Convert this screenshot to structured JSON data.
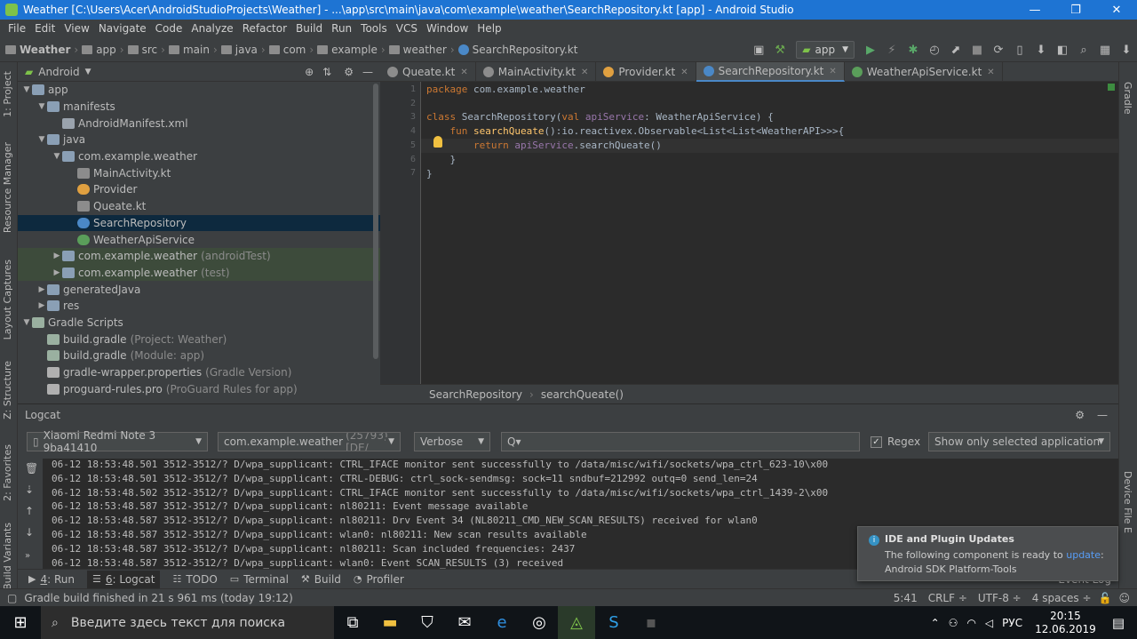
{
  "title": "Weather [C:\\Users\\Acer\\AndroidStudioProjects\\Weather] - ...\\app\\src\\main\\java\\com\\example\\weather\\SearchRepository.kt [app] - Android Studio",
  "menu": [
    "File",
    "Edit",
    "View",
    "Navigate",
    "Code",
    "Analyze",
    "Refactor",
    "Build",
    "Run",
    "Tools",
    "VCS",
    "Window",
    "Help"
  ],
  "breadcrumbs": [
    "Weather",
    "app",
    "src",
    "main",
    "java",
    "com",
    "example",
    "weather",
    "SearchRepository.kt"
  ],
  "run_config": "app",
  "left_tabs": [
    "1: Project",
    "Resource Manager",
    "Layout Captures",
    "Z: Structure",
    "2: Favorites",
    "Build Variants"
  ],
  "right_tabs": [
    "Gradle",
    "Device File E"
  ],
  "project": {
    "view": "Android",
    "tree": [
      {
        "label": "app",
        "extra": "",
        "indent": 0,
        "arrow": "▼",
        "icon": "folder",
        "sel": false,
        "hl": false
      },
      {
        "label": "manifests",
        "extra": "",
        "indent": 1,
        "arrow": "▼",
        "icon": "folder",
        "sel": false,
        "hl": false
      },
      {
        "label": "AndroidManifest.xml",
        "extra": "",
        "indent": 2,
        "arrow": "",
        "icon": "xml",
        "sel": false,
        "hl": false
      },
      {
        "label": "java",
        "extra": "",
        "indent": 1,
        "arrow": "▼",
        "icon": "folder",
        "sel": false,
        "hl": false
      },
      {
        "label": "com.example.weather",
        "extra": "",
        "indent": 2,
        "arrow": "▼",
        "icon": "folder",
        "sel": false,
        "hl": false
      },
      {
        "label": "MainActivity.kt",
        "extra": "",
        "indent": 3,
        "arrow": "",
        "icon": "kt",
        "sel": false,
        "hl": false
      },
      {
        "label": "Provider",
        "extra": "",
        "indent": 3,
        "arrow": "",
        "icon": "obj",
        "sel": false,
        "hl": false
      },
      {
        "label": "Queate.kt",
        "extra": "",
        "indent": 3,
        "arrow": "",
        "icon": "kt",
        "sel": false,
        "hl": false
      },
      {
        "label": "SearchRepository",
        "extra": "",
        "indent": 3,
        "arrow": "",
        "icon": "cls",
        "sel": true,
        "hl": false
      },
      {
        "label": "WeatherApiService",
        "extra": "",
        "indent": 3,
        "arrow": "",
        "icon": "iface",
        "sel": false,
        "hl": false
      },
      {
        "label": "com.example.weather",
        "extra": "(androidTest)",
        "indent": 2,
        "arrow": "▶",
        "icon": "folder",
        "sel": false,
        "hl": true
      },
      {
        "label": "com.example.weather",
        "extra": "(test)",
        "indent": 2,
        "arrow": "▶",
        "icon": "folder",
        "sel": false,
        "hl": true
      },
      {
        "label": "generatedJava",
        "extra": "",
        "indent": 1,
        "arrow": "▶",
        "icon": "folder",
        "sel": false,
        "hl": false
      },
      {
        "label": "res",
        "extra": "",
        "indent": 1,
        "arrow": "▶",
        "icon": "folder",
        "sel": false,
        "hl": false
      },
      {
        "label": "Gradle Scripts",
        "extra": "",
        "indent": 0,
        "arrow": "▼",
        "icon": "gradle",
        "sel": false,
        "hl": false
      },
      {
        "label": "build.gradle",
        "extra": "(Project: Weather)",
        "indent": 1,
        "arrow": "",
        "icon": "gradle",
        "sel": false,
        "hl": false
      },
      {
        "label": "build.gradle",
        "extra": "(Module: app)",
        "indent": 1,
        "arrow": "",
        "icon": "gradle",
        "sel": false,
        "hl": false
      },
      {
        "label": "gradle-wrapper.properties",
        "extra": "(Gradle Version)",
        "indent": 1,
        "arrow": "",
        "icon": "props",
        "sel": false,
        "hl": false
      },
      {
        "label": "proguard-rules.pro",
        "extra": "(ProGuard Rules for app)",
        "indent": 1,
        "arrow": "",
        "icon": "pro",
        "sel": false,
        "hl": false
      }
    ]
  },
  "editor_tabs": [
    {
      "label": "Queate.kt",
      "active": false,
      "color": "#8c8c8c"
    },
    {
      "label": "MainActivity.kt",
      "active": false,
      "color": "#8c8c8c"
    },
    {
      "label": "Provider.kt",
      "active": false,
      "color": "#e0a040"
    },
    {
      "label": "SearchRepository.kt",
      "active": true,
      "color": "#4a88c7"
    },
    {
      "label": "WeatherApiService.kt",
      "active": false,
      "color": "#5a9e5a"
    }
  ],
  "code_lines": [
    "1",
    "2",
    "3",
    "4",
    "5",
    "6",
    "7"
  ],
  "code": {
    "l1_kw": "package",
    "l1_rest": " com.example.weather",
    "l3_kw": "class",
    "l3_name": " SearchRepository(",
    "l3_val": "val ",
    "l3_param": "apiService",
    "l3_rest": ": WeatherApiService) {",
    "l4_kw": "fun ",
    "l4_fn": "searchQueate",
    "l4_rest": "():io.reactivex.Observable<List<List<WeatherAPI>>>{",
    "l5_kw": "return ",
    "l5_param": "apiService",
    "l5_rest": ".searchQueate()",
    "l6": "    }",
    "l7": "}"
  },
  "editor_breadcrumb": [
    "SearchRepository",
    "searchQueate()"
  ],
  "logcat": {
    "title": "Logcat",
    "device": "Xiaomi Redmi Note 3 9ba41410",
    "process": "com.example.weather",
    "process_pid": "(25793) [DE/",
    "level": "Verbose",
    "search_placeholder": "Q▾",
    "regex_label": "Regex",
    "filter": "Show only selected application",
    "lines": [
      "06-12 18:53:48.501 3512-3512/? D/wpa_supplicant: CTRL_IFACE monitor sent successfully to /data/misc/wifi/sockets/wpa_ctrl_623-10\\x00",
      "06-12 18:53:48.501 3512-3512/? D/wpa_supplicant: CTRL-DEBUG: ctrl_sock-sendmsg: sock=11 sndbuf=212992 outq=0 send_len=24",
      "06-12 18:53:48.502 3512-3512/? D/wpa_supplicant: CTRL_IFACE monitor sent successfully to /data/misc/wifi/sockets/wpa_ctrl_1439-2\\x00",
      "06-12 18:53:48.587 3512-3512/? D/wpa_supplicant: nl80211: Event message available",
      "06-12 18:53:48.587 3512-3512/? D/wpa_supplicant: nl80211: Drv Event 34 (NL80211_CMD_NEW_SCAN_RESULTS) received for wlan0",
      "06-12 18:53:48.587 3512-3512/? D/wpa_supplicant: wlan0: nl80211: New scan results available",
      "06-12 18:53:48.587 3512-3512/? D/wpa_supplicant: nl80211: Scan included frequencies: 2437",
      "06-12 18:53:48.587 3512-3512/? D/wpa_supplicant: wlan0: Event SCAN_RESULTS (3) received"
    ]
  },
  "bottom_tabs": [
    {
      "num": "4",
      "label": ": Run",
      "icon": "▶",
      "active": false
    },
    {
      "num": "6",
      "label": ": Logcat",
      "icon": "☰",
      "active": true
    },
    {
      "num": "",
      "label": "TODO",
      "icon": "☷",
      "active": false
    },
    {
      "num": "",
      "label": "Terminal",
      "icon": "▭",
      "active": false
    },
    {
      "num": "",
      "label": "Build",
      "icon": "⚒",
      "active": false
    },
    {
      "num": "",
      "label": "Profiler",
      "icon": "◔",
      "active": false
    }
  ],
  "event_log": "Event Log",
  "notification": {
    "title": "IDE and Plugin Updates",
    "text1": "The following component is ready to ",
    "link": "update",
    "text2": ":",
    "text3": "Android SDK Platform-Tools"
  },
  "status": {
    "message": "Gradle build finished in 21 s 961 ms (today 19:12)",
    "position": "5:41",
    "line_sep": "CRLF ÷",
    "encoding": "UTF-8 ÷",
    "indent": "4 spaces ÷"
  },
  "taskbar": {
    "search_placeholder": "Введите здесь текст для поиска",
    "lang": "РУС",
    "time": "20:15",
    "date": "12.06.2019"
  },
  "colors": {
    "titlebar": "#1e74d3",
    "accent": "#4a88c7",
    "panel": "#3c3f41",
    "editor": "#2b2b2b"
  }
}
